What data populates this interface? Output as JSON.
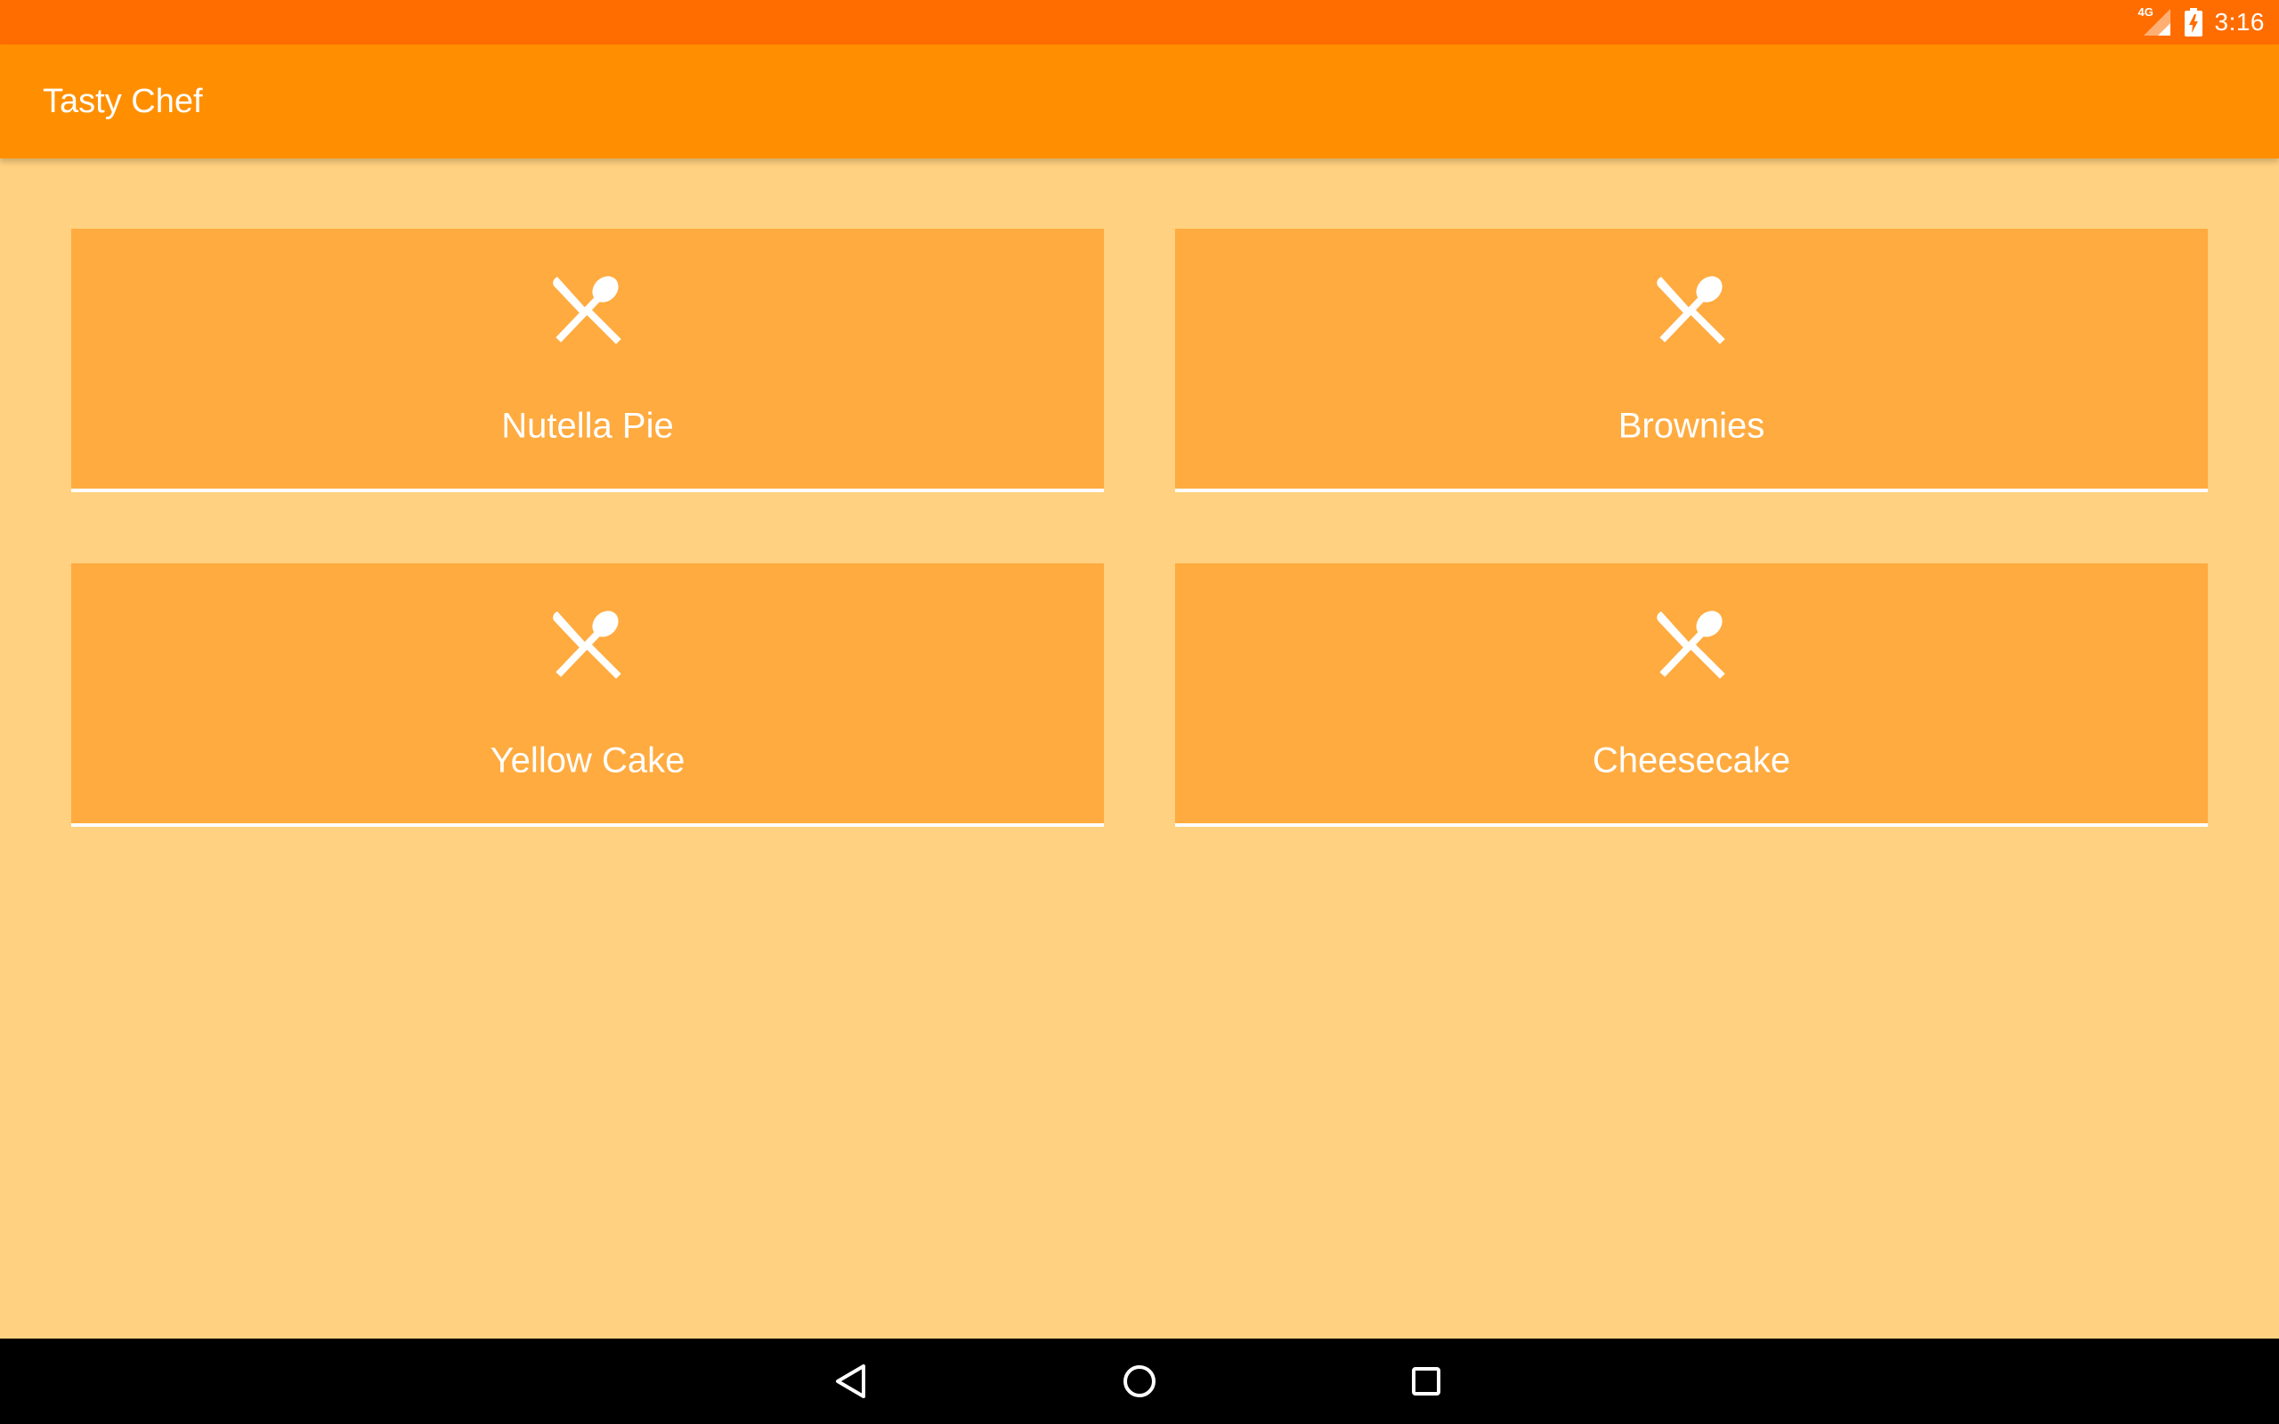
{
  "status_bar": {
    "network_type": "4G",
    "time": "3:16",
    "icons": [
      "signal-icon",
      "battery-charging-icon"
    ]
  },
  "app_bar": {
    "title": "Tasty Chef"
  },
  "recipes": [
    {
      "label": "Nutella Pie",
      "icon": "utensils-icon"
    },
    {
      "label": "Brownies",
      "icon": "utensils-icon"
    },
    {
      "label": "Yellow Cake",
      "icon": "utensils-icon"
    },
    {
      "label": "Cheesecake",
      "icon": "utensils-icon"
    }
  ],
  "nav_bar": {
    "buttons": [
      "back-icon",
      "home-icon",
      "recents-icon"
    ]
  },
  "colors": {
    "status_bar": "#FF6D00",
    "app_bar": "#FF8F00",
    "background": "#FFD180",
    "card": "#FFAB40",
    "text": "#FFFFFF",
    "nav_bar": "#000000"
  }
}
